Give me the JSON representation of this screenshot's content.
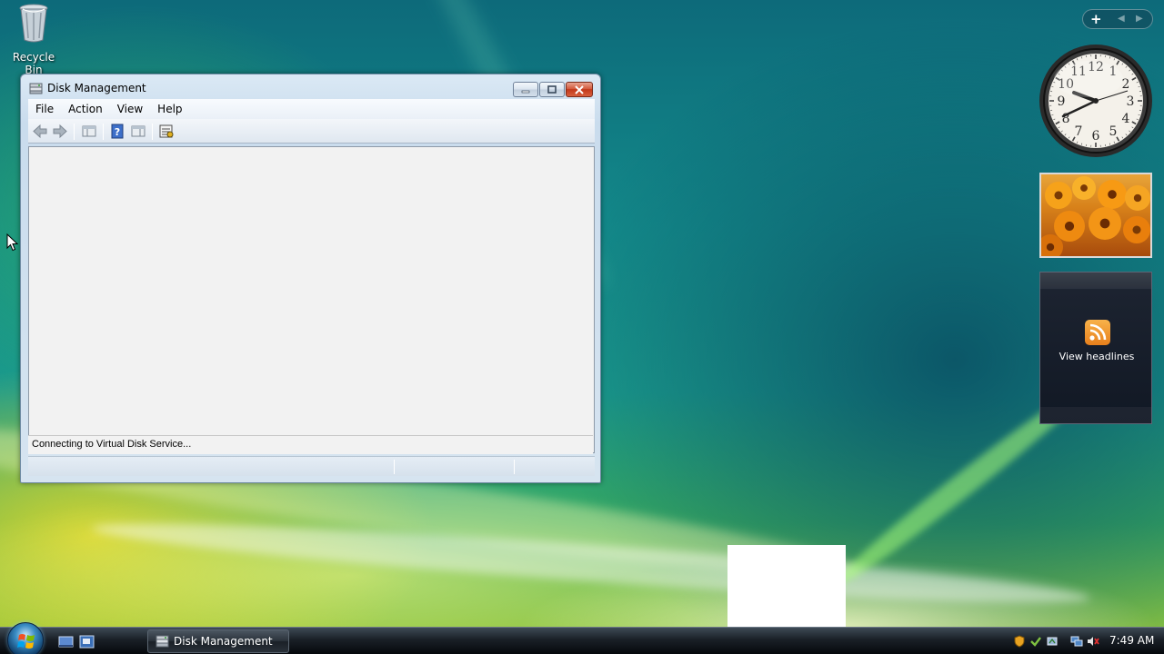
{
  "desktop": {
    "recycle_bin_label": "Recycle Bin"
  },
  "window": {
    "title": "Disk Management",
    "menu": [
      "File",
      "Action",
      "View",
      "Help"
    ],
    "status_message": "Connecting to Virtual Disk Service...",
    "toolbar_icons": [
      "back-arrow-icon",
      "forward-arrow-icon",
      "show-hide-console-tree-icon",
      "help-icon",
      "show-hide-action-pane-icon",
      "properties-icon"
    ]
  },
  "sidebar": {
    "clock": {
      "numbers": [
        "12",
        "1",
        "2",
        "3",
        "4",
        "5",
        "6",
        "7",
        "8",
        "9",
        "10",
        "11"
      ]
    },
    "feed_label": "View headlines"
  },
  "taskbar": {
    "task_label": "Disk Management",
    "time": "7:49 AM"
  },
  "colors": {
    "taskbar": "#1a2027",
    "window_frame": "#c9dced",
    "close_button": "#c2381a",
    "rss_orange": "#e8801c"
  }
}
